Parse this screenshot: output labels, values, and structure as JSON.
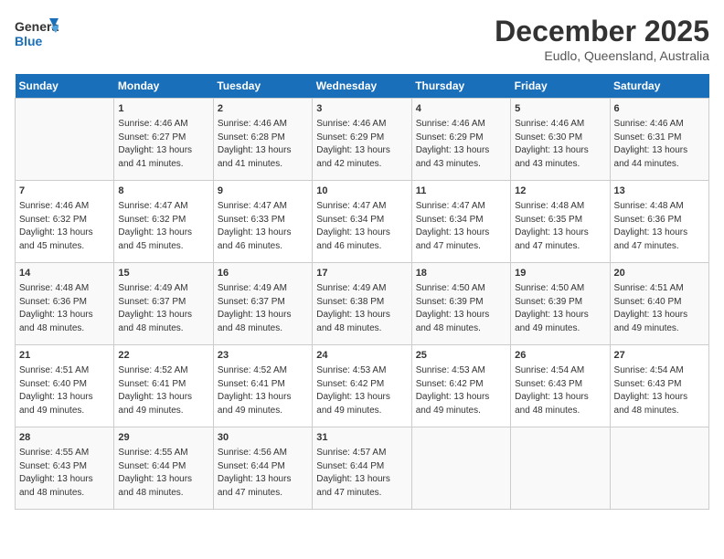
{
  "logo": {
    "general": "General",
    "blue": "Blue"
  },
  "title": "December 2025",
  "subtitle": "Eudlo, Queensland, Australia",
  "days_header": [
    "Sunday",
    "Monday",
    "Tuesday",
    "Wednesday",
    "Thursday",
    "Friday",
    "Saturday"
  ],
  "weeks": [
    [
      {
        "day": "",
        "content": ""
      },
      {
        "day": "1",
        "content": "Sunrise: 4:46 AM\nSunset: 6:27 PM\nDaylight: 13 hours\nand 41 minutes."
      },
      {
        "day": "2",
        "content": "Sunrise: 4:46 AM\nSunset: 6:28 PM\nDaylight: 13 hours\nand 41 minutes."
      },
      {
        "day": "3",
        "content": "Sunrise: 4:46 AM\nSunset: 6:29 PM\nDaylight: 13 hours\nand 42 minutes."
      },
      {
        "day": "4",
        "content": "Sunrise: 4:46 AM\nSunset: 6:29 PM\nDaylight: 13 hours\nand 43 minutes."
      },
      {
        "day": "5",
        "content": "Sunrise: 4:46 AM\nSunset: 6:30 PM\nDaylight: 13 hours\nand 43 minutes."
      },
      {
        "day": "6",
        "content": "Sunrise: 4:46 AM\nSunset: 6:31 PM\nDaylight: 13 hours\nand 44 minutes."
      }
    ],
    [
      {
        "day": "7",
        "content": "Sunrise: 4:46 AM\nSunset: 6:32 PM\nDaylight: 13 hours\nand 45 minutes."
      },
      {
        "day": "8",
        "content": "Sunrise: 4:47 AM\nSunset: 6:32 PM\nDaylight: 13 hours\nand 45 minutes."
      },
      {
        "day": "9",
        "content": "Sunrise: 4:47 AM\nSunset: 6:33 PM\nDaylight: 13 hours\nand 46 minutes."
      },
      {
        "day": "10",
        "content": "Sunrise: 4:47 AM\nSunset: 6:34 PM\nDaylight: 13 hours\nand 46 minutes."
      },
      {
        "day": "11",
        "content": "Sunrise: 4:47 AM\nSunset: 6:34 PM\nDaylight: 13 hours\nand 47 minutes."
      },
      {
        "day": "12",
        "content": "Sunrise: 4:48 AM\nSunset: 6:35 PM\nDaylight: 13 hours\nand 47 minutes."
      },
      {
        "day": "13",
        "content": "Sunrise: 4:48 AM\nSunset: 6:36 PM\nDaylight: 13 hours\nand 47 minutes."
      }
    ],
    [
      {
        "day": "14",
        "content": "Sunrise: 4:48 AM\nSunset: 6:36 PM\nDaylight: 13 hours\nand 48 minutes."
      },
      {
        "day": "15",
        "content": "Sunrise: 4:49 AM\nSunset: 6:37 PM\nDaylight: 13 hours\nand 48 minutes."
      },
      {
        "day": "16",
        "content": "Sunrise: 4:49 AM\nSunset: 6:37 PM\nDaylight: 13 hours\nand 48 minutes."
      },
      {
        "day": "17",
        "content": "Sunrise: 4:49 AM\nSunset: 6:38 PM\nDaylight: 13 hours\nand 48 minutes."
      },
      {
        "day": "18",
        "content": "Sunrise: 4:50 AM\nSunset: 6:39 PM\nDaylight: 13 hours\nand 48 minutes."
      },
      {
        "day": "19",
        "content": "Sunrise: 4:50 AM\nSunset: 6:39 PM\nDaylight: 13 hours\nand 49 minutes."
      },
      {
        "day": "20",
        "content": "Sunrise: 4:51 AM\nSunset: 6:40 PM\nDaylight: 13 hours\nand 49 minutes."
      }
    ],
    [
      {
        "day": "21",
        "content": "Sunrise: 4:51 AM\nSunset: 6:40 PM\nDaylight: 13 hours\nand 49 minutes."
      },
      {
        "day": "22",
        "content": "Sunrise: 4:52 AM\nSunset: 6:41 PM\nDaylight: 13 hours\nand 49 minutes."
      },
      {
        "day": "23",
        "content": "Sunrise: 4:52 AM\nSunset: 6:41 PM\nDaylight: 13 hours\nand 49 minutes."
      },
      {
        "day": "24",
        "content": "Sunrise: 4:53 AM\nSunset: 6:42 PM\nDaylight: 13 hours\nand 49 minutes."
      },
      {
        "day": "25",
        "content": "Sunrise: 4:53 AM\nSunset: 6:42 PM\nDaylight: 13 hours\nand 49 minutes."
      },
      {
        "day": "26",
        "content": "Sunrise: 4:54 AM\nSunset: 6:43 PM\nDaylight: 13 hours\nand 48 minutes."
      },
      {
        "day": "27",
        "content": "Sunrise: 4:54 AM\nSunset: 6:43 PM\nDaylight: 13 hours\nand 48 minutes."
      }
    ],
    [
      {
        "day": "28",
        "content": "Sunrise: 4:55 AM\nSunset: 6:43 PM\nDaylight: 13 hours\nand 48 minutes."
      },
      {
        "day": "29",
        "content": "Sunrise: 4:55 AM\nSunset: 6:44 PM\nDaylight: 13 hours\nand 48 minutes."
      },
      {
        "day": "30",
        "content": "Sunrise: 4:56 AM\nSunset: 6:44 PM\nDaylight: 13 hours\nand 47 minutes."
      },
      {
        "day": "31",
        "content": "Sunrise: 4:57 AM\nSunset: 6:44 PM\nDaylight: 13 hours\nand 47 minutes."
      },
      {
        "day": "",
        "content": ""
      },
      {
        "day": "",
        "content": ""
      },
      {
        "day": "",
        "content": ""
      }
    ]
  ]
}
